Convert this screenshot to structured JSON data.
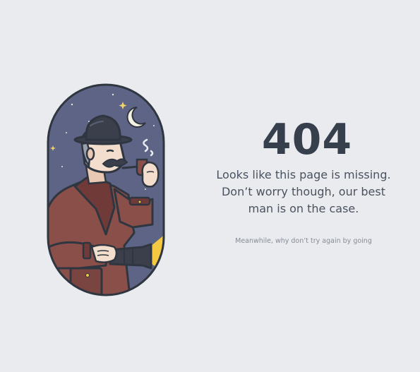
{
  "error": {
    "code": "404",
    "message_lines": [
      "Looks like this page is missing.",
      "Don’t worry though, our best",
      "man is on the case."
    ],
    "sub_message": "Meanwhile, why don’t try again by going"
  },
  "illustration": {
    "subject": "detective-with-pipe-and-flashlight",
    "colors": {
      "night_sky": "#5d6486",
      "outline": "#2f3640",
      "coat": "#8b4f4a",
      "hat": "#3a3f4b",
      "skin": "#f3ddcc",
      "moon": "#f3f1e4",
      "light_beam": "#f5c842"
    }
  },
  "page": {
    "background": "#eaebee"
  }
}
